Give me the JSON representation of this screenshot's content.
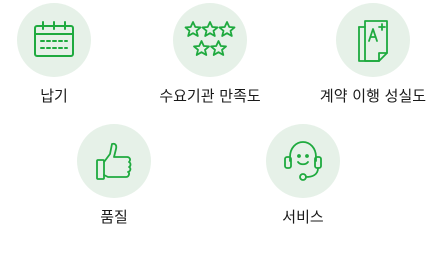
{
  "colors": {
    "circle_bg": "#e6f1e8",
    "icon_stroke": "#1faa3f",
    "label_text": "#1a1a1a"
  },
  "items": [
    {
      "label": "납기",
      "icon": "calendar-icon"
    },
    {
      "label": "수요기관 만족도",
      "icon": "stars-icon"
    },
    {
      "label": "계약 이행 성실도",
      "icon": "a-plus-document-icon"
    },
    {
      "label": "품질",
      "icon": "thumbs-up-icon"
    },
    {
      "label": "서비스",
      "icon": "headset-icon"
    }
  ]
}
